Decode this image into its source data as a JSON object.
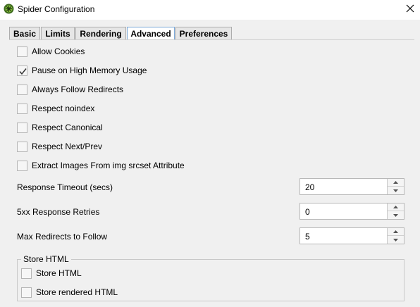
{
  "window": {
    "title": "Spider Configuration"
  },
  "tabs": [
    {
      "label": "Basic",
      "active": false
    },
    {
      "label": "Limits",
      "active": false
    },
    {
      "label": "Rendering",
      "active": false
    },
    {
      "label": "Advanced",
      "active": true
    },
    {
      "label": "Preferences",
      "active": false
    }
  ],
  "options": [
    {
      "label": "Allow Cookies",
      "checked": false
    },
    {
      "label": "Pause on High Memory Usage",
      "checked": true
    },
    {
      "label": "Always Follow Redirects",
      "checked": false
    },
    {
      "label": "Respect noindex",
      "checked": false
    },
    {
      "label": "Respect Canonical",
      "checked": false
    },
    {
      "label": "Respect Next/Prev",
      "checked": false
    },
    {
      "label": "Extract Images From img srcset Attribute",
      "checked": false
    }
  ],
  "fields": [
    {
      "label": "Response Timeout (secs)",
      "value": "20"
    },
    {
      "label": "5xx Response Retries",
      "value": "0"
    },
    {
      "label": "Max Redirects to Follow",
      "value": "5"
    }
  ],
  "store_html": {
    "title": "Store HTML",
    "options": [
      {
        "label": "Store HTML",
        "checked": false
      },
      {
        "label": "Store rendered HTML",
        "checked": false
      }
    ]
  },
  "icons": {
    "app": "spider-icon",
    "close": "close-icon",
    "check": "checkmark-icon",
    "spin_up": "chevron-up-icon",
    "spin_down": "chevron-down-icon"
  }
}
